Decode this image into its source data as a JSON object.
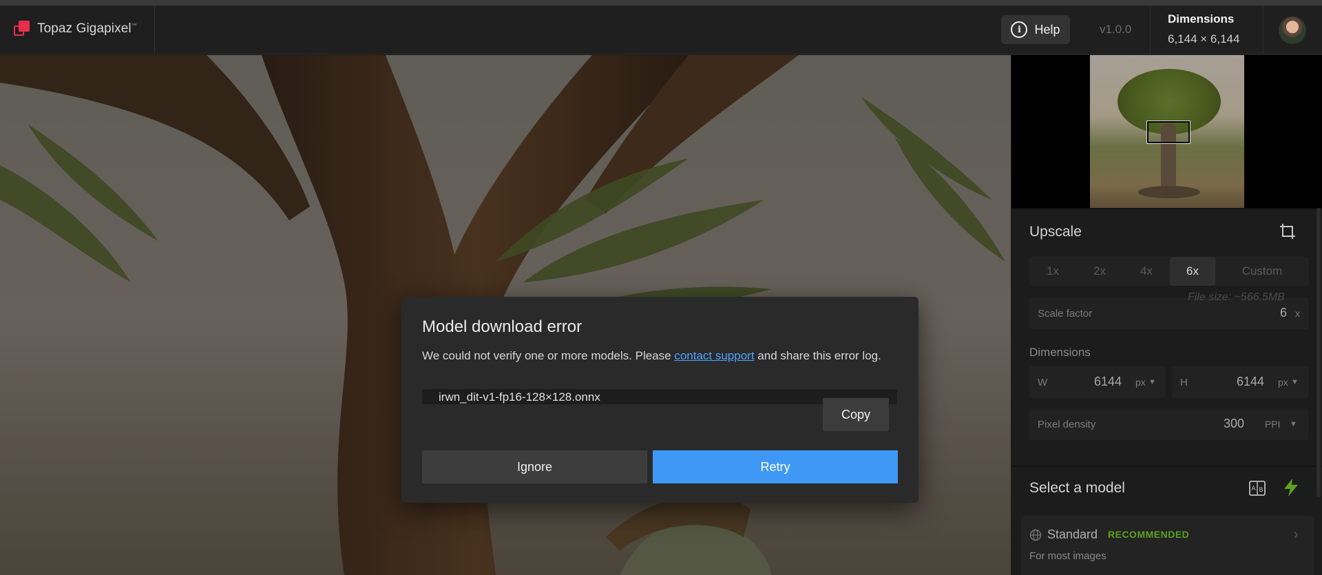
{
  "app": {
    "name": "Topaz Gigapixel",
    "trademark": "™",
    "brand_color": "#e8304d"
  },
  "header": {
    "help_label": "Help",
    "version": "v1.0.0",
    "dimensions_label": "Dimensions",
    "dimensions_value": "6,144 × 6,144"
  },
  "upscale": {
    "title": "Upscale",
    "scale_options": [
      {
        "label": "1x",
        "active": false
      },
      {
        "label": "2x",
        "active": false
      },
      {
        "label": "4x",
        "active": false
      },
      {
        "label": "6x",
        "active": true
      },
      {
        "label": "Custom",
        "active": false
      }
    ],
    "scale_factor_label": "Scale factor",
    "scale_factor_value": "6",
    "scale_factor_unit": "x",
    "dimensions_title": "Dimensions",
    "file_size": "File size: ~566.5MB",
    "width_label": "W",
    "width_value": "6144",
    "width_unit": "px",
    "height_label": "H",
    "height_value": "6144",
    "height_unit": "px",
    "pixel_density_label": "Pixel density",
    "pixel_density_value": "300",
    "pixel_density_unit": "PPI"
  },
  "model": {
    "title": "Select a model",
    "items": [
      {
        "name": "Standard",
        "badge": "RECOMMENDED",
        "description": "For most images"
      }
    ],
    "accent_color": "#5fa21d"
  },
  "dialog": {
    "title": "Model download error",
    "message_before": "We could not verify one or more models. Please ",
    "link_text": "contact support",
    "message_after": " and share this error log.",
    "log_line": "irwn_dit-v1-fp16-128×128.onnx",
    "copy_label": "Copy",
    "ignore_label": "Ignore",
    "retry_label": "Retry",
    "retry_color": "#3f98f5"
  }
}
